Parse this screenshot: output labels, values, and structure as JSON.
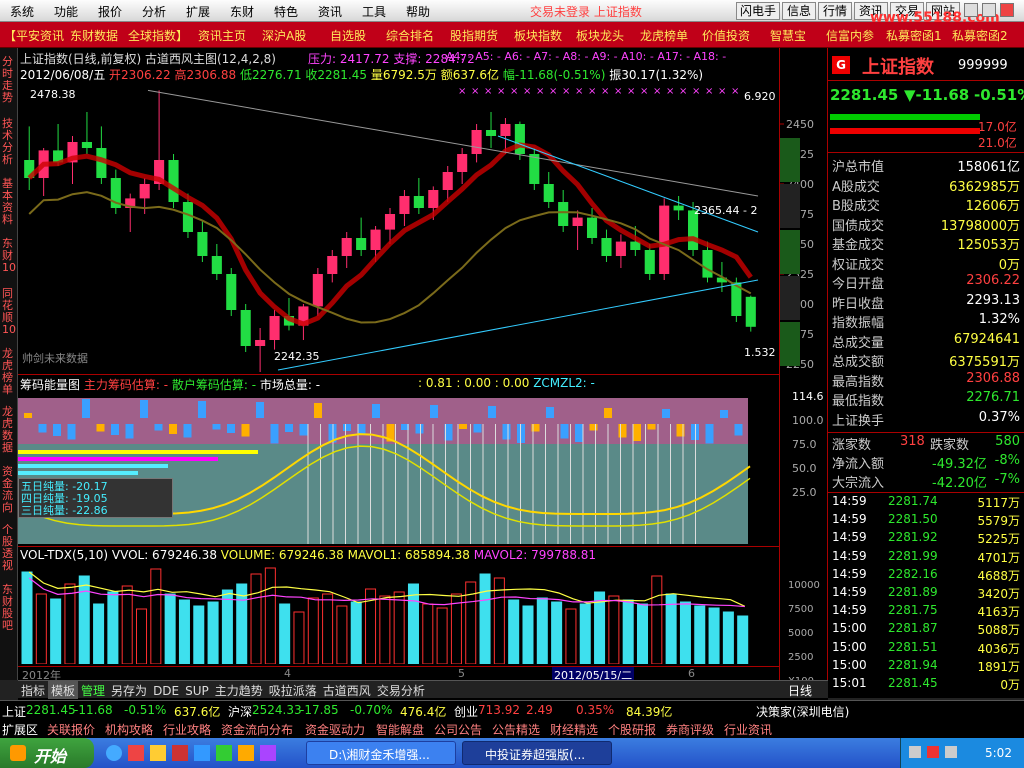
{
  "menubar": {
    "items": [
      "系统",
      "功能",
      "报价",
      "分析",
      "扩展",
      "东财",
      "特色",
      "资讯",
      "工具",
      "帮助"
    ],
    "right": [
      "闪电手",
      "信息",
      "行情",
      "资讯",
      "交易",
      "网站"
    ],
    "watermark": "www.55188.com",
    "hint": "交易未登录 上证指数"
  },
  "navbar": {
    "items": [
      "【平安资讯",
      "东财数据",
      "全球指数】",
      "资讯主页",
      "深沪A股",
      "自选股",
      "综合排名",
      "股指期货",
      "板块指数",
      "板块龙头",
      "龙虎榜单",
      "价值投资",
      "智慧宝",
      "信富内参",
      "私募密函1",
      "私募密函2"
    ]
  },
  "left_tabs": [
    "分时走势",
    "技术分析",
    "基本资料",
    "东财10",
    "同花顺10",
    "龙虎榜单",
    "龙虎数据",
    "资金流向",
    "个股透视",
    "东财股吧"
  ],
  "chart_header": {
    "title": "上证指数(日线,前复权) 古道西风主图(12,4,2,8)",
    "pressure": "压力: 2417.72",
    "support": "支撑: 2284.72",
    "labels": "A4: -  A5: -  A6: -  A7: -  A8: -  A9: -  A10: -  A17: -  A18: -",
    "ohlc_date": "2012/06/08/五",
    "open": "开2306.22",
    "high": "高2306.88",
    "low": "低2276.71",
    "close": "收2281.45",
    "vol": "量6792.5万",
    "amount": "额637.6亿",
    "range": "幅-11.68(-0.51%)",
    "amp": "振30.17(1.32%)"
  },
  "chart_marks": {
    "high_label": "2478.38",
    "low_label": "2242.35",
    "right_label": "6.920",
    "mid_label": "2365.44 - 2",
    "bottom_label": "1.532",
    "future": "帅剑未来数据"
  },
  "chart_data": {
    "type": "bar",
    "title": "上证指数(日线,前复权)",
    "ylim": [
      2250,
      2475
    ],
    "yticks": [
      2450,
      2425,
      2400,
      2375,
      2350,
      2325,
      2300,
      2275,
      2250
    ],
    "candles": [
      [
        2420,
        2448,
        2395,
        2405
      ],
      [
        2405,
        2430,
        2390,
        2428
      ],
      [
        2428,
        2450,
        2415,
        2418
      ],
      [
        2418,
        2440,
        2400,
        2435
      ],
      [
        2435,
        2460,
        2425,
        2430
      ],
      [
        2430,
        2448,
        2400,
        2405
      ],
      [
        2405,
        2412,
        2375,
        2380
      ],
      [
        2380,
        2392,
        2360,
        2388
      ],
      [
        2388,
        2405,
        2375,
        2400
      ],
      [
        2400,
        2478,
        2395,
        2420
      ],
      [
        2420,
        2425,
        2380,
        2385
      ],
      [
        2385,
        2392,
        2355,
        2360
      ],
      [
        2360,
        2370,
        2335,
        2340
      ],
      [
        2340,
        2350,
        2320,
        2325
      ],
      [
        2325,
        2330,
        2290,
        2295
      ],
      [
        2295,
        2300,
        2260,
        2265
      ],
      [
        2265,
        2280,
        2242,
        2270
      ],
      [
        2270,
        2295,
        2262,
        2290
      ],
      [
        2290,
        2305,
        2278,
        2282
      ],
      [
        2282,
        2300,
        2270,
        2298
      ],
      [
        2298,
        2330,
        2290,
        2325
      ],
      [
        2325,
        2345,
        2318,
        2340
      ],
      [
        2340,
        2360,
        2330,
        2355
      ],
      [
        2355,
        2372,
        2340,
        2345
      ],
      [
        2345,
        2365,
        2335,
        2362
      ],
      [
        2362,
        2380,
        2350,
        2375
      ],
      [
        2375,
        2395,
        2365,
        2390
      ],
      [
        2390,
        2405,
        2375,
        2380
      ],
      [
        2380,
        2398,
        2370,
        2395
      ],
      [
        2395,
        2415,
        2385,
        2410
      ],
      [
        2410,
        2430,
        2400,
        2425
      ],
      [
        2425,
        2450,
        2418,
        2445
      ],
      [
        2445,
        2460,
        2430,
        2440
      ],
      [
        2440,
        2455,
        2425,
        2450
      ],
      [
        2450,
        2452,
        2420,
        2425
      ],
      [
        2425,
        2430,
        2395,
        2400
      ],
      [
        2400,
        2410,
        2380,
        2385
      ],
      [
        2385,
        2395,
        2360,
        2365
      ],
      [
        2365,
        2378,
        2345,
        2372
      ],
      [
        2372,
        2380,
        2350,
        2355
      ],
      [
        2355,
        2362,
        2335,
        2340
      ],
      [
        2340,
        2358,
        2330,
        2352
      ],
      [
        2352,
        2365,
        2340,
        2345
      ],
      [
        2345,
        2350,
        2320,
        2325
      ],
      [
        2325,
        2388,
        2320,
        2382
      ],
      [
        2382,
        2390,
        2370,
        2378
      ],
      [
        2378,
        2385,
        2340,
        2345
      ],
      [
        2345,
        2352,
        2318,
        2322
      ],
      [
        2322,
        2335,
        2310,
        2318
      ],
      [
        2318,
        2322,
        2285,
        2290
      ],
      [
        2306,
        2307,
        2277,
        2281
      ]
    ],
    "ind_label": "筹码能量图",
    "ind_main": "主力筹码估算: -",
    "ind_retail": "散户筹码估算: -",
    "ind_market": "市场总量: -",
    "ind_vals": ": 0.81 : 0.00 : 0.00",
    "ind_zc": "ZCMZL2: -",
    "five": "五日纯量: -20.17",
    "four": "四日纯量: -19.05",
    "three": "三日纯量: -22.86",
    "vol_title": "VOL-TDX(5,10)",
    "vol_wvol": "VVOL: 679246.38",
    "vol_volume": "VOLUME: 679246.38",
    "vol_ma1": "MAVOL1: 685894.38",
    "vol_ma2": "MAVOL2: 799788.81",
    "volumes": [
      92,
      70,
      65,
      80,
      88,
      60,
      72,
      78,
      55,
      95,
      70,
      64,
      58,
      62,
      74,
      80,
      90,
      96,
      60,
      52,
      66,
      70,
      58,
      62,
      75,
      68,
      72,
      80,
      60,
      56,
      70,
      82,
      90,
      86,
      64,
      58,
      66,
      62,
      55,
      60,
      72,
      68,
      64,
      60,
      88,
      70,
      62,
      58,
      56,
      52,
      48
    ],
    "ind_axis": [
      "114.6",
      "100.0",
      "75.0",
      "50.0",
      "25.0"
    ],
    "vol_axis": [
      "10000",
      "7500",
      "5000",
      "2500",
      "X100"
    ],
    "date_labels": [
      "2012年",
      "4",
      "5",
      "2012/05/15/二",
      "6"
    ]
  },
  "info": {
    "name": "上证指数",
    "code": "999999",
    "last": "2281.45",
    "chg": "▼-11.68",
    "pct": "-0.51%",
    "bar_top": "17.0亿",
    "bar_bot": "21.0亿",
    "rows": [
      [
        "沪总市值",
        "158061亿",
        "wht"
      ],
      [
        "A股成交",
        "6362985万",
        "yel"
      ],
      [
        "B股成交",
        "12606万",
        "yel"
      ],
      [
        "国债成交",
        "13798000万",
        "yel"
      ],
      [
        "基金成交",
        "125053万",
        "yel"
      ],
      [
        "权证成交",
        "0万",
        "yel"
      ],
      [
        "今日开盘",
        "2306.22",
        "red"
      ],
      [
        "昨日收盘",
        "2293.13",
        "wht"
      ],
      [
        "指数振幅",
        "1.32%",
        "wht"
      ],
      [
        "总成交量",
        "67924641",
        "yel"
      ],
      [
        "总成交额",
        "6375591万",
        "yel"
      ],
      [
        "最高指数",
        "2306.88",
        "red"
      ],
      [
        "最低指数",
        "2276.71",
        "grn"
      ],
      [
        "上证换手",
        "0.37%",
        "wht"
      ]
    ],
    "up_label": "涨家数",
    "up": "318",
    "down_label": "跌家数",
    "down": "580",
    "net_in_label": "净流入额",
    "net_in": "-49.32亿",
    "net_in_pct": "-8%",
    "big_label": "大宗流入",
    "big": "-42.20亿",
    "big_pct": "-7%",
    "ticks": [
      [
        "14:59",
        "2281.74",
        "5117万"
      ],
      [
        "14:59",
        "2281.50",
        "5579万"
      ],
      [
        "14:59",
        "2281.92",
        "5225万"
      ],
      [
        "14:59",
        "2281.99",
        "4701万"
      ],
      [
        "14:59",
        "2282.16",
        "4688万"
      ],
      [
        "14:59",
        "2281.89",
        "3420万"
      ],
      [
        "14:59",
        "2281.75",
        "4163万"
      ],
      [
        "15:00",
        "2281.87",
        "5088万"
      ],
      [
        "15:00",
        "2281.51",
        "4036万"
      ],
      [
        "15:00",
        "2281.94",
        "1891万"
      ],
      [
        "15:01",
        "2281.45",
        "0万"
      ]
    ],
    "tabs": [
      "笔",
      "价",
      "细",
      "盘",
      "势",
      "指",
      "值",
      "筹"
    ]
  },
  "bottom_tabs": [
    "指标",
    "模板",
    "管理",
    "另存为",
    "DDE",
    "SUP",
    "主力趋势",
    "吸拉派落",
    "古道西风",
    "交易分析"
  ],
  "bottom_right": "日线",
  "status": {
    "items": [
      [
        "上证",
        "2281.45",
        "-11.68",
        "-0.51%",
        "637.6亿"
      ],
      [
        "沪深",
        "2524.33",
        "-17.85",
        "-0.70%",
        "476.4亿"
      ],
      [
        "创业",
        "713.92",
        "2.49",
        "0.35%",
        "84.39亿"
      ]
    ],
    "right": "决策家(深圳电信)"
  },
  "quickstrip": [
    "扩展区",
    "关联报价",
    "机构攻略",
    "行业攻略",
    "资金流向分布",
    "资金驱动力",
    "智能解盘",
    "公司公告",
    "公告精选",
    "财经精选",
    "个股研报",
    "券商评级",
    "行业资讯"
  ],
  "taskbar": {
    "start": "开始",
    "task1": "D:\\湘财金禾增强...",
    "task2": "中投证券超强版(...",
    "time": "5:02"
  }
}
